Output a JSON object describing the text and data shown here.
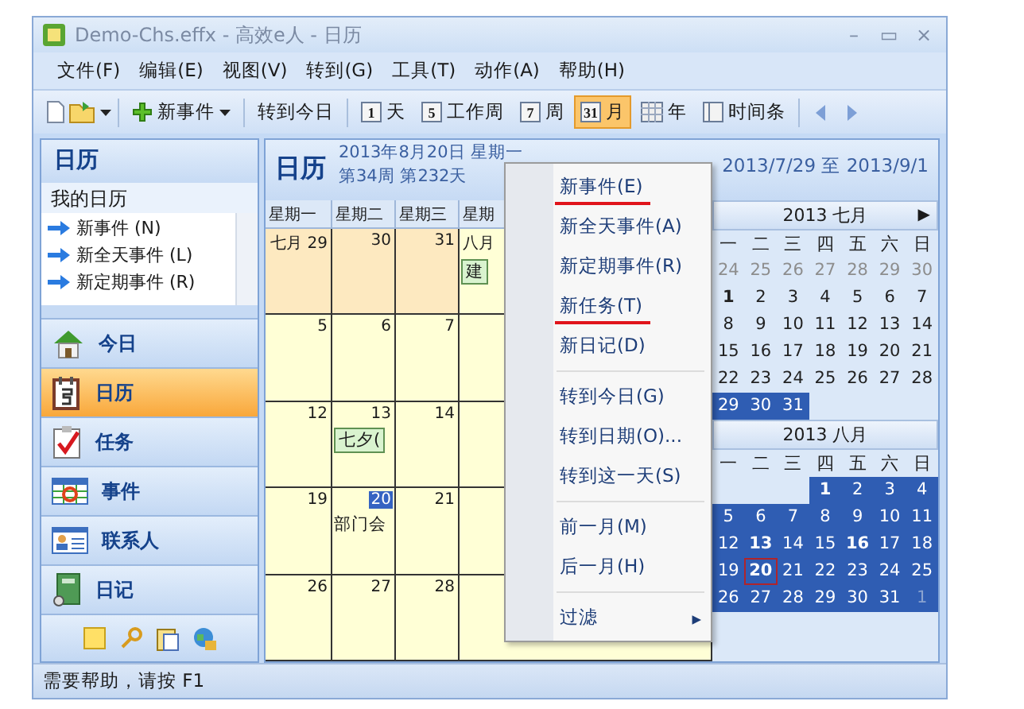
{
  "window": {
    "title": "Demo-Chs.effx - 高效e人 - 日历",
    "controls": [
      "–",
      "▭",
      "×"
    ]
  },
  "menu": [
    "文件(F)",
    "编辑(E)",
    "视图(V)",
    "转到(G)",
    "工具(T)",
    "动作(A)",
    "帮助(H)"
  ],
  "toolbar": [
    {
      "kind": "newdoc"
    },
    {
      "kind": "open",
      "dropdown": true
    },
    {
      "kind": "plus",
      "label": "新事件",
      "dropdown": true
    },
    {
      "kind": "text",
      "label": "转到今日"
    },
    {
      "kind": "num",
      "icon": "1",
      "label": "天",
      "selected": false
    },
    {
      "kind": "num",
      "icon": "5",
      "label": "工作周",
      "selected": false
    },
    {
      "kind": "num",
      "icon": "7",
      "label": "周",
      "selected": false
    },
    {
      "kind": "num",
      "icon": "31",
      "label": "月",
      "selected": true
    },
    {
      "kind": "year",
      "label": "年",
      "selected": false
    },
    {
      "kind": "timeline",
      "label": "时间条",
      "selected": false
    },
    {
      "kind": "back"
    },
    {
      "kind": "forward"
    }
  ],
  "sidebar": {
    "title": "日历",
    "section": "我的日历",
    "actions": [
      "新事件 (N)",
      "新全天事件 (L)",
      "新定期事件 (R)"
    ],
    "nav": [
      {
        "kind": "house",
        "label": "今日",
        "selected": false
      },
      {
        "kind": "calendar",
        "label": "日历",
        "selected": true
      },
      {
        "kind": "task",
        "label": "任务",
        "selected": false
      },
      {
        "kind": "event",
        "label": "事件",
        "selected": false
      },
      {
        "kind": "contact",
        "label": "联系人",
        "selected": false
      },
      {
        "kind": "diary",
        "label": "日记",
        "selected": false
      }
    ],
    "shortcuts": [
      {
        "kind": "note"
      },
      {
        "kind": "key"
      },
      {
        "kind": "clipboard"
      },
      {
        "kind": "globe"
      }
    ]
  },
  "calendar": {
    "title": "日历",
    "date": "2013年8月20日 星期一",
    "week": "第34周 第232天",
    "range": "2013/7/29 至 2013/9/1",
    "weekdays": [
      "星期一",
      "星期二",
      "星期三",
      "星期"
    ],
    "weeks": [
      [
        {
          "day": "七月 29",
          "other": true
        },
        {
          "day": "30",
          "other": true
        },
        {
          "day": "31",
          "other": true
        },
        {
          "day": "八月",
          "other": false,
          "event": "建"
        }
      ],
      [
        {
          "day": "5",
          "other": false
        },
        {
          "day": "6",
          "other": false
        },
        {
          "day": "7",
          "other": false
        },
        {
          "other": false
        }
      ],
      [
        {
          "day": "12",
          "other": false
        },
        {
          "day": "13",
          "other": false,
          "event": "七夕("
        },
        {
          "day": "14",
          "other": false
        },
        {
          "other": false
        }
      ],
      [
        {
          "day": "19",
          "other": false
        },
        {
          "day": "20",
          "other": false,
          "today": true,
          "note": "部门会"
        },
        {
          "day": "21",
          "other": false
        },
        {
          "other": false
        }
      ],
      [
        {
          "day": "26",
          "other": false
        },
        {
          "day": "27",
          "other": false
        },
        {
          "day": "28",
          "other": false
        },
        {
          "other": false
        }
      ]
    ]
  },
  "mini_calendar": {
    "months": [
      {
        "title": "2013 七月",
        "arrow": "▶",
        "weekdays": [
          "一",
          "二",
          "三",
          "四",
          "五",
          "六",
          "日"
        ],
        "weeks": [
          [
            {
              "d": "24",
              "kind": "muted"
            },
            {
              "d": "25",
              "kind": "muted"
            },
            {
              "d": "26",
              "kind": "muted"
            },
            {
              "d": "27",
              "kind": "muted"
            },
            {
              "d": "28",
              "kind": "muted"
            },
            {
              "d": "29",
              "kind": "muted"
            },
            {
              "d": "30",
              "kind": "muted"
            }
          ],
          [
            {
              "d": "1",
              "kind": "bold"
            },
            {
              "d": "2",
              "kind": "plain"
            },
            {
              "d": "3",
              "kind": "plain"
            },
            {
              "d": "4",
              "kind": "plain"
            },
            {
              "d": "5",
              "kind": "plain"
            },
            {
              "d": "6",
              "kind": "plain"
            },
            {
              "d": "7",
              "kind": "plain"
            }
          ],
          [
            {
              "d": "8",
              "kind": "plain"
            },
            {
              "d": "9",
              "kind": "plain"
            },
            {
              "d": "10",
              "kind": "plain"
            },
            {
              "d": "11",
              "kind": "plain"
            },
            {
              "d": "12",
              "kind": "plain"
            },
            {
              "d": "13",
              "kind": "plain"
            },
            {
              "d": "14",
              "kind": "plain"
            }
          ],
          [
            {
              "d": "15",
              "kind": "plain"
            },
            {
              "d": "16",
              "kind": "plain"
            },
            {
              "d": "17",
              "kind": "plain"
            },
            {
              "d": "18",
              "kind": "plain"
            },
            {
              "d": "19",
              "kind": "plain"
            },
            {
              "d": "20",
              "kind": "plain"
            },
            {
              "d": "21",
              "kind": "plain"
            }
          ],
          [
            {
              "d": "22",
              "kind": "plain"
            },
            {
              "d": "23",
              "kind": "plain"
            },
            {
              "d": "24",
              "kind": "plain"
            },
            {
              "d": "25",
              "kind": "plain"
            },
            {
              "d": "26",
              "kind": "plain"
            },
            {
              "d": "27",
              "kind": "plain"
            },
            {
              "d": "28",
              "kind": "plain"
            }
          ],
          [
            {
              "d": "29",
              "kind": "plain",
              "selected": true
            },
            {
              "d": "30",
              "kind": "plain",
              "selected": true
            },
            {
              "d": "31",
              "kind": "plain",
              "selected": true
            }
          ]
        ]
      },
      {
        "title": "2013 八月",
        "weekdays": [
          "一",
          "二",
          "三",
          "四",
          "五",
          "六",
          "日"
        ],
        "weeks": [
          [
            {
              "kind": "blank"
            },
            {
              "kind": "blank"
            },
            {
              "kind": "blank"
            },
            {
              "d": "1",
              "kind": "bold",
              "selected": true
            },
            {
              "d": "2",
              "kind": "plain",
              "selected": true
            },
            {
              "d": "3",
              "kind": "plain",
              "selected": true
            },
            {
              "d": "4",
              "kind": "plain",
              "selected": true
            }
          ],
          [
            {
              "d": "5",
              "kind": "plain",
              "selected": true
            },
            {
              "d": "6",
              "kind": "plain",
              "selected": true
            },
            {
              "d": "7",
              "kind": "plain",
              "selected": true
            },
            {
              "d": "8",
              "kind": "plain",
              "selected": true
            },
            {
              "d": "9",
              "kind": "plain",
              "selected": true
            },
            {
              "d": "10",
              "kind": "plain",
              "selected": true
            },
            {
              "d": "11",
              "kind": "plain",
              "selected": true
            }
          ],
          [
            {
              "d": "12",
              "kind": "plain",
              "selected": true
            },
            {
              "d": "13",
              "kind": "bold",
              "selected": true
            },
            {
              "d": "14",
              "kind": "plain",
              "selected": true
            },
            {
              "d": "15",
              "kind": "plain",
              "selected": true
            },
            {
              "d": "16",
              "kind": "bold",
              "selected": true
            },
            {
              "d": "17",
              "kind": "plain",
              "selected": true
            },
            {
              "d": "18",
              "kind": "plain",
              "selected": true
            }
          ],
          [
            {
              "d": "19",
              "kind": "plain",
              "selected": true
            },
            {
              "d": "20",
              "kind": "today",
              "selected": true
            },
            {
              "d": "21",
              "kind": "plain",
              "selected": true
            },
            {
              "d": "22",
              "kind": "plain",
              "selected": true
            },
            {
              "d": "23",
              "kind": "plain",
              "selected": true
            },
            {
              "d": "24",
              "kind": "plain",
              "selected": true
            },
            {
              "d": "25",
              "kind": "plain",
              "selected": true
            }
          ],
          [
            {
              "d": "26",
              "kind": "plain",
              "selected": true
            },
            {
              "d": "27",
              "kind": "plain",
              "selected": true
            },
            {
              "d": "28",
              "kind": "plain",
              "selected": true
            },
            {
              "d": "29",
              "kind": "plain",
              "selected": true
            },
            {
              "d": "30",
              "kind": "plain",
              "selected": true
            },
            {
              "d": "31",
              "kind": "plain",
              "selected": true
            },
            {
              "d": "1",
              "kind": "muted",
              "selected": true
            }
          ]
        ]
      }
    ]
  },
  "context_menu": [
    {
      "kind": "item",
      "label": "新事件(E)",
      "highlighted": true
    },
    {
      "kind": "item",
      "label": "新全天事件(A)",
      "highlighted": false
    },
    {
      "kind": "item",
      "label": "新定期事件(R)",
      "highlighted": false
    },
    {
      "kind": "item",
      "label": "新任务(T)",
      "highlighted": true
    },
    {
      "kind": "item",
      "label": "新日记(D)",
      "highlighted": false
    },
    {
      "kind": "separator"
    },
    {
      "kind": "item",
      "label": "转到今日(G)",
      "highlighted": false
    },
    {
      "kind": "item",
      "label": "转到日期(O)...",
      "highlighted": false
    },
    {
      "kind": "item",
      "label": "转到这一天(S)",
      "highlighted": false
    },
    {
      "kind": "separator"
    },
    {
      "kind": "item",
      "label": "前一月(M)",
      "highlighted": false
    },
    {
      "kind": "item",
      "label": "后一月(H)",
      "highlighted": false
    },
    {
      "kind": "separator"
    },
    {
      "kind": "submenu",
      "label": "过滤",
      "arrow": "▸",
      "highlighted": false
    }
  ],
  "status_bar": "需要帮助，请按 F1"
}
